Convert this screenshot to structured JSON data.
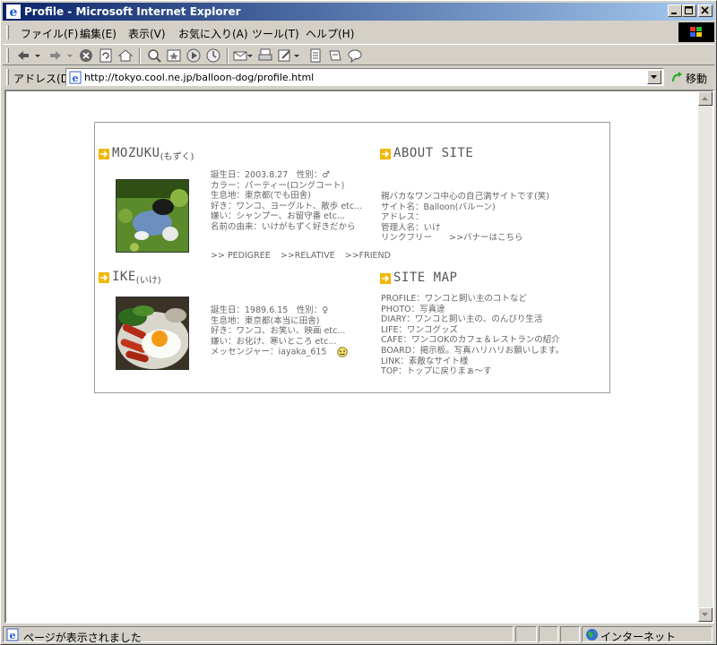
{
  "window": {
    "title": "Profile - Microsoft Internet Explorer"
  },
  "menu": {
    "items": [
      "ファイル(F)",
      "編集(E)",
      "表示(V)",
      "お気に入り(A)",
      "ツール(T)",
      "ヘルプ(H)"
    ]
  },
  "address": {
    "label": "アドレス(D)",
    "url": "http://tokyo.cool.ne.jp/balloon-dog/profile.html",
    "go_label": "移動"
  },
  "profile": {
    "mozuku": {
      "name": "MOZUKU",
      "reading": "(もずく)",
      "lines": [
        "誕生日：2003.8.27　性別：♂",
        "カラー：パーティー(ロングコート)",
        "生息地：東京都(でも田舎)",
        "好き：ワンコ、ヨーグルト、散歩 etc...",
        "嫌い：シャンプー、お留守番 etc...",
        "名前の由来：いけがもずく好きだから"
      ],
      "links": [
        ">> PEDIGREE",
        ">>RELATIVE",
        ">>FRIEND"
      ]
    },
    "ike": {
      "name": "IKE",
      "reading": "(いけ)",
      "lines": [
        "誕生日：1989.6.15　性別：♀",
        "生息地：東京都(本当に田舎)",
        "好き：ワンコ、お笑い、映画 etc...",
        "嫌い：お化け、寒いところ etc..."
      ],
      "messenger": "メッセンジャー：iayaka_615"
    }
  },
  "about": {
    "title": "ABOUT SITE",
    "lines": [
      "親バカなワンコ中心の自己満サイトです(笑)",
      "サイト名：Balloon(バルーン)",
      "アドレス：",
      "管理人名：いけ"
    ],
    "link_free": "リンクフリー",
    "banner_link": ">>バナーはこちら"
  },
  "sitemap": {
    "title": "SITE MAP",
    "items": [
      "PROFILE：ワンコと飼い主のコトなど",
      "PHOTO：写真達",
      "DIARY：ワンコと飼い主の、のんびり生活",
      "LIFE：ワンコグッズ",
      "CAFE：ワンコOKのカフェ＆レストランの紹介",
      "BOARD：掲示板。写真ハリハリお願いします。",
      "LINK：素敵なサイト様",
      "TOP：トップに戻りまぁ～す"
    ]
  },
  "status": {
    "text": "ページが表示されました",
    "zone": "インターネット"
  },
  "colors": {
    "title_bar_start": "#0a246a",
    "title_bar_end": "#a6caf0",
    "section_icon": "#f2b705",
    "content_text": "#666666"
  }
}
